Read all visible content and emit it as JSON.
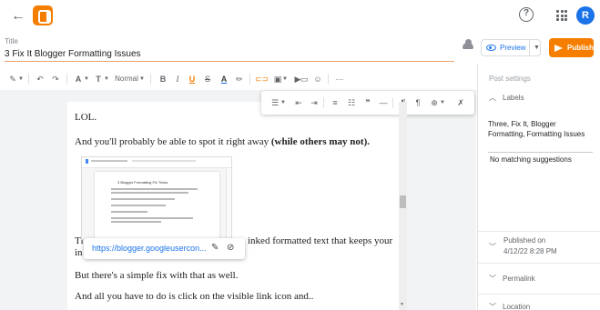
{
  "header": {
    "back_glyph": "←",
    "help_glyph": "?",
    "avatar_initial": "R"
  },
  "title_field": {
    "label": "Title",
    "value": "3 Fix It Blogger Formatting Issues"
  },
  "actions": {
    "preview_label": "Preview",
    "publish_label": "Publish"
  },
  "toolbar": {
    "paragraph_style": "Normal",
    "bold": "B",
    "italic": "I",
    "underline": "U",
    "strike": "S",
    "text_color": "A",
    "more": "···"
  },
  "editor": {
    "paragraphs": [
      {
        "plain": "LOL.",
        "bold": ""
      },
      {
        "plain": "And you'll probably be able to spot it right away ",
        "bold": "(while others may not)."
      },
      {
        "plain_start": "Th",
        "plain_end": "inked formatted text that keeps your",
        "line2_start": "in"
      },
      {
        "plain": "But there's a simple fix with that as well.",
        "bold": ""
      },
      {
        "plain": "And all you have to do is click on the visible link icon and..",
        "bold": ""
      }
    ],
    "embedded_title": "3 Blogger Formatting Fix Tricks",
    "link_popup_url": "https://blogger.googleusercon..."
  },
  "sidebar": {
    "heading": "Post settings",
    "labels_title": "Labels",
    "labels_value": "Three, Fix It, Blogger Formatting, Formatting Issues",
    "no_match": "No matching suggestions",
    "published_label": "Published on",
    "published_value": "4/12/22 8:28 PM",
    "permalink_label": "Permalink",
    "location_label": "Location"
  },
  "colors": {
    "accent": "#f57d00",
    "link": "#1a73e8",
    "avatar": "#1a73e8"
  },
  "icons": [
    "back-arrow-icon",
    "blogger-logo-icon",
    "help-icon",
    "apps-grid-icon",
    "cloud-saved-icon",
    "eye-icon",
    "send-icon",
    "pencil-icon",
    "unlink-icon",
    "chevron-up-icon",
    "chevron-down-icon"
  ]
}
